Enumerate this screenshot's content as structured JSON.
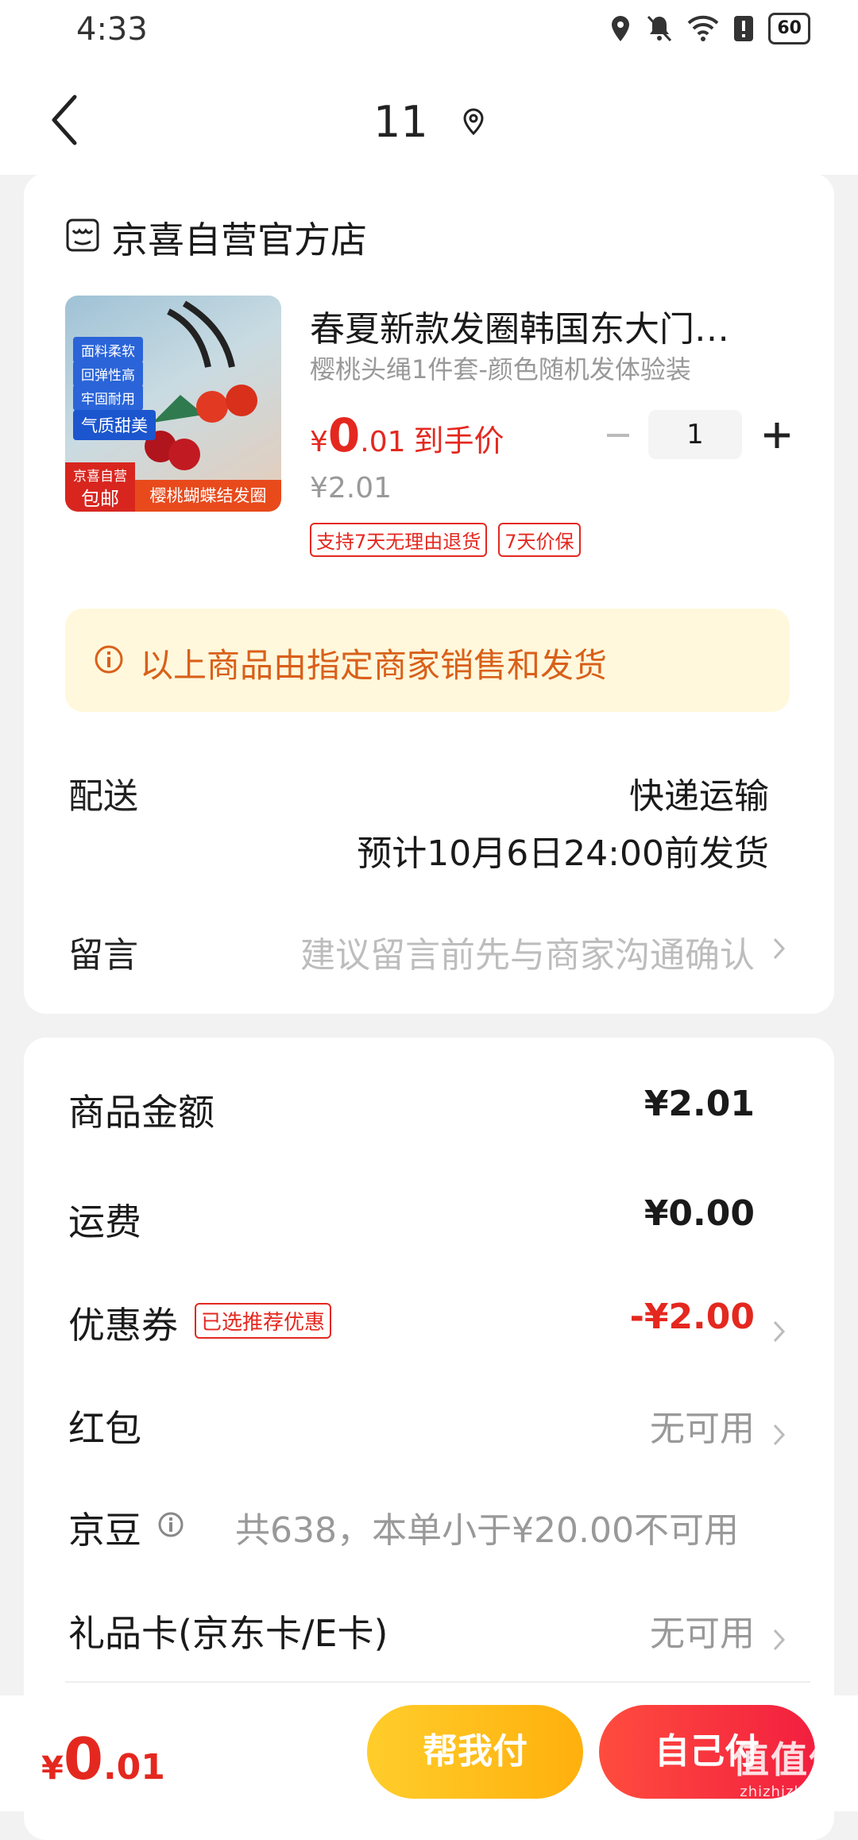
{
  "status_bar": {
    "time": "4:33",
    "battery": "60"
  },
  "header": {
    "title": "11"
  },
  "store": {
    "name": "京喜自营官方店"
  },
  "product": {
    "thumb": {
      "tags": [
        "面料柔软",
        "回弹性高",
        "牢固耐用",
        "气质甜美"
      ],
      "corner_top": "京喜自营",
      "corner_bottom": "包邮",
      "banner": "樱桃蝴蝶结发圈"
    },
    "title": "春夏新款发圈韩国东大门…",
    "spec": "樱桃头绳1件套-颜色随机发体验装",
    "price_currency": "¥",
    "price_int": "0",
    "price_dec": ".01",
    "price_label": "到手价",
    "original_price": "¥2.01",
    "quantity": "1",
    "badges": [
      "支持7天无理由退货",
      "7天价保"
    ]
  },
  "notice": {
    "text": "以上商品由指定商家销售和发货"
  },
  "delivery": {
    "label": "配送",
    "method": "快递运输",
    "estimate": "预计10月6日24:00前发货"
  },
  "message": {
    "label": "留言",
    "placeholder": "建议留言前先与商家沟通确认"
  },
  "summary": {
    "goods_amount": {
      "label": "商品金额",
      "value": "¥2.01"
    },
    "shipping": {
      "label": "运费",
      "value": "¥0.00"
    },
    "coupon": {
      "label": "优惠券",
      "badge": "已选推荐优惠",
      "value": "-¥2.00"
    },
    "red_packet": {
      "label": "红包",
      "value": "无可用"
    },
    "jd_beans": {
      "label": "京豆",
      "value": "共638，本单小于¥20.00不可用"
    },
    "gift_card": {
      "label": "礼品卡(京东卡/E卡)",
      "value": "无可用"
    }
  },
  "footer": {
    "total_currency": "¥",
    "total_int": "0",
    "total_dec": ".01",
    "help_pay": "帮我付",
    "self_pay": "自己付",
    "watermark": "值值值",
    "watermark_url": "zhizhizhi.com"
  },
  "colors": {
    "accent_red": "#e4281f",
    "pay_yellow": "#ffb00d",
    "notice_bg": "#fff8dc"
  }
}
